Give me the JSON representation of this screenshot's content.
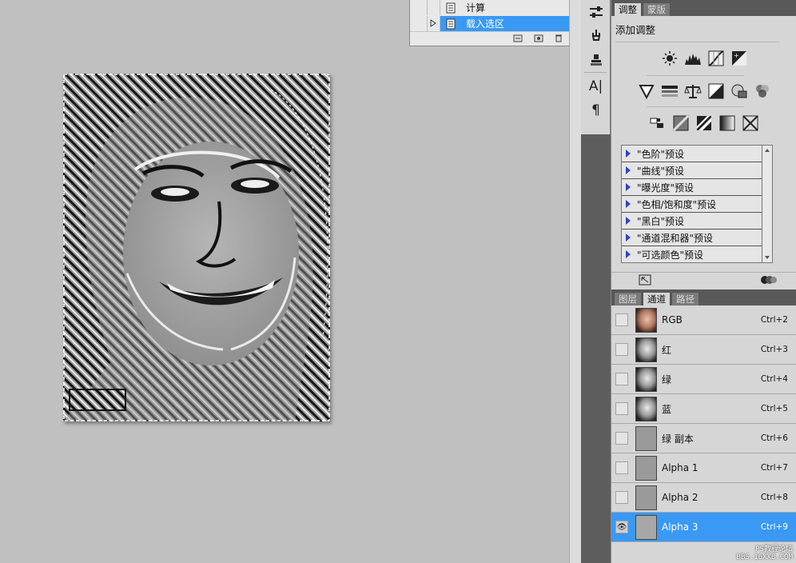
{
  "actions": {
    "rows": [
      {
        "label": "计算"
      },
      {
        "label": "载入选区"
      }
    ]
  },
  "adjustments": {
    "tabs": [
      "调整",
      "蒙版"
    ],
    "title": "添加调整",
    "presets": [
      "\"色阶\"预设",
      "\"曲线\"预设",
      "\"曝光度\"预设",
      "\"色相/饱和度\"预设",
      "\"黑白\"预设",
      "\"通道混和器\"预设",
      "\"可选颜色\"预设"
    ]
  },
  "channels_panel": {
    "tabs": [
      "图层",
      "通道",
      "路径"
    ],
    "channels": [
      {
        "name": "RGB",
        "shortcut": "Ctrl+2"
      },
      {
        "name": "红",
        "shortcut": "Ctrl+3"
      },
      {
        "name": "绿",
        "shortcut": "Ctrl+4"
      },
      {
        "name": "蓝",
        "shortcut": "Ctrl+5"
      },
      {
        "name": "绿 副本",
        "shortcut": "Ctrl+6"
      },
      {
        "name": "Alpha 1",
        "shortcut": "Ctrl+7"
      },
      {
        "name": "Alpha 2",
        "shortcut": "Ctrl+8"
      },
      {
        "name": "Alpha 3",
        "shortcut": "Ctrl+9"
      }
    ]
  },
  "watermark": {
    "line1": "PS教程论坛",
    "line2": "BBS.16XX8.COM"
  },
  "colors": {
    "selection": "#3a99f5",
    "panel": "#d6d6d6",
    "workspace": "#c0c0c0"
  }
}
